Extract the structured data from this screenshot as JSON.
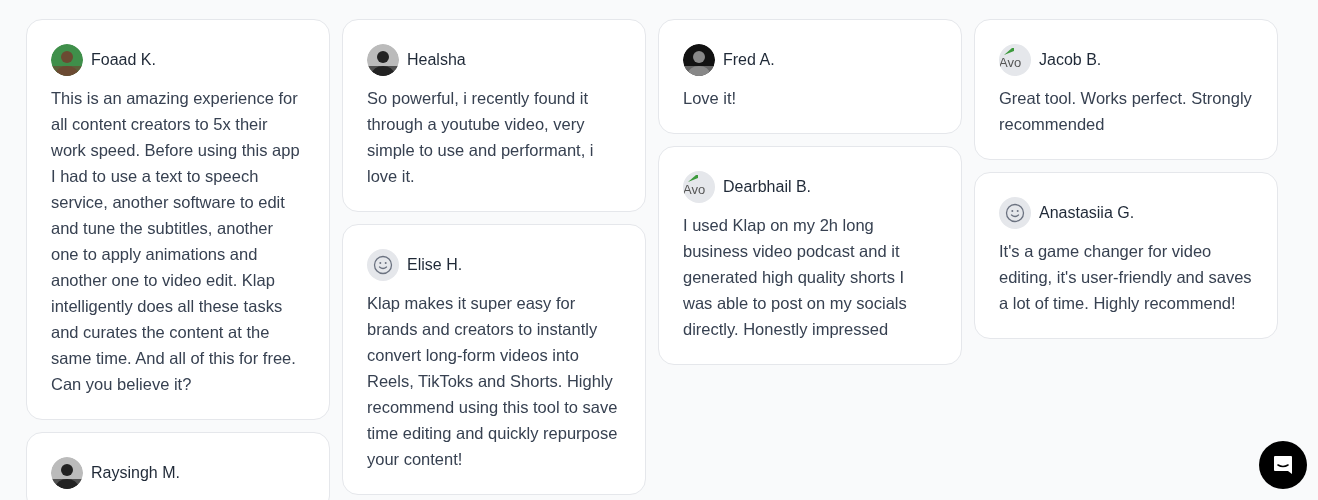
{
  "columns": [
    [
      {
        "name": "Foaad K.",
        "text": "This is an amazing experience for all content creators to 5x their work speed. Before using this app I had to use a text to speech service, another software to edit and tune the subtitles, another one to apply animations and another one to video edit. Klap intelligently does all these tasks and curates the content at the same time. And all of this for free. Can you believe it?"
      },
      {
        "name": "Raysingh M."
      }
    ],
    [
      {
        "name": "Healsha",
        "text": "So powerful, i recently found it through a youtube video, very simple to use and performant, i love it."
      },
      {
        "name": "Elise H.",
        "avatar": {
          "kind": "default"
        },
        "text": "Klap makes it super easy for brands and creators to instantly convert long-form videos into Reels, TikToks and Shorts. Highly recommend using this tool to save time editing and quickly repurpose your content!"
      }
    ],
    [
      {
        "name": "Fred A.",
        "text": "Love it!"
      },
      {
        "name": "Dearbhail B.",
        "avatar": {
          "kind": "broken",
          "alt": "Avo"
        },
        "text": "I used Klap on my 2h long business video podcast and it generated high quality shorts I was able to post on my socials directly. Honestly impressed"
      }
    ],
    [
      {
        "name": "Jacob B.",
        "avatar": {
          "kind": "broken",
          "alt": "Avo"
        },
        "text": "Great tool. Works perfect. Strongly recommended"
      },
      {
        "name": "Anastasiia G.",
        "avatar": {
          "kind": "default"
        },
        "text": "It's a game changer for video editing, it's user-friendly and saves a lot of time. Highly recommend!"
      }
    ]
  ]
}
